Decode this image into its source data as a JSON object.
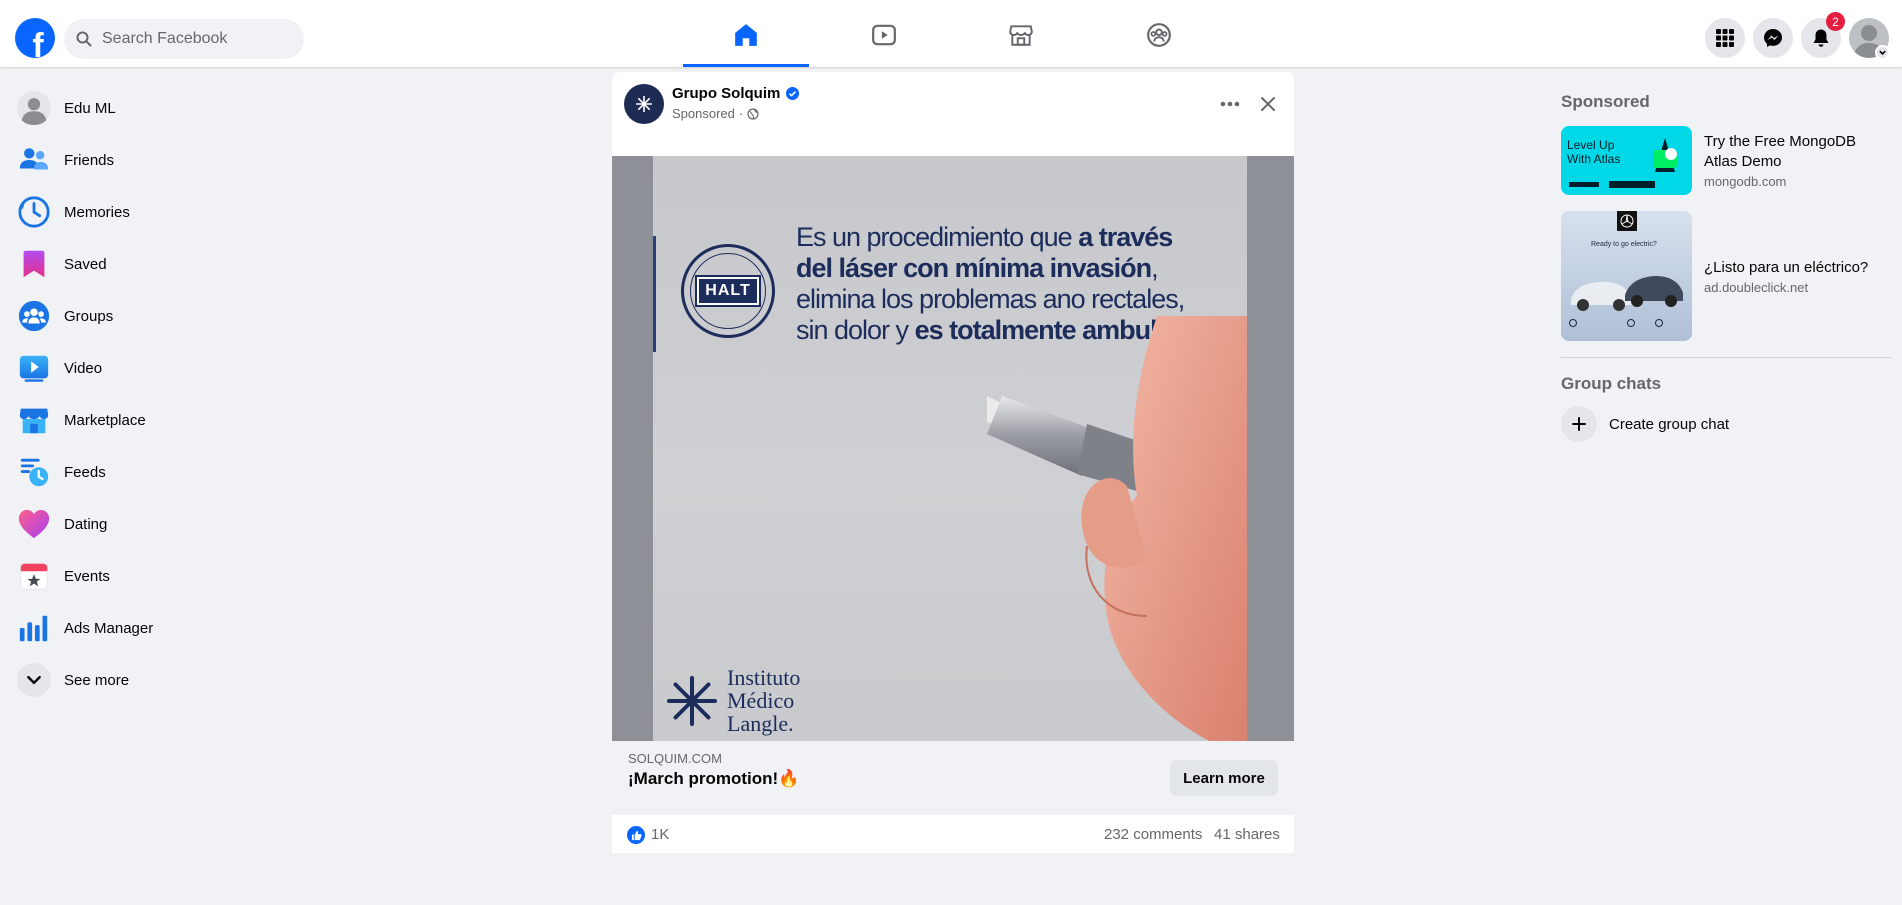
{
  "header": {
    "logo_letter": "f",
    "search_placeholder": "Search Facebook",
    "tabs": [
      "home-tab",
      "video-tab",
      "marketplace-tab",
      "groups-tab"
    ],
    "notifications_badge": "2"
  },
  "sidebar": {
    "items": [
      {
        "label": "Edu ML",
        "icon": "profile-avatar"
      },
      {
        "label": "Friends",
        "icon": "friends-icon"
      },
      {
        "label": "Memories",
        "icon": "memories-icon"
      },
      {
        "label": "Saved",
        "icon": "saved-icon"
      },
      {
        "label": "Groups",
        "icon": "groups-icon"
      },
      {
        "label": "Video",
        "icon": "video-icon"
      },
      {
        "label": "Marketplace",
        "icon": "marketplace-icon"
      },
      {
        "label": "Feeds",
        "icon": "feeds-icon"
      },
      {
        "label": "Dating",
        "icon": "dating-icon"
      },
      {
        "label": "Events",
        "icon": "events-icon"
      },
      {
        "label": "Ads Manager",
        "icon": "ads-manager-icon"
      },
      {
        "label": "See more",
        "icon": "chevron-down-icon"
      }
    ]
  },
  "post": {
    "page_name": "Grupo Solquim",
    "meta": "Sponsored",
    "meta_separator": "·",
    "image": {
      "headline_1": "Es un procedimiento que ",
      "headline_1b": "a través",
      "headline_2b": "del láser con mínima invasión",
      "headline_2": ",",
      "headline_3": "elimina los problemas ano rectales,",
      "headline_4": "sin dolor y ",
      "headline_4b": "es totalmente ambulatorio.",
      "seal_text": "HALT",
      "logo_line1": "Instituto",
      "logo_line2": "Médico",
      "logo_line3": "Langle."
    },
    "link_domain": "SOLQUIM.COM",
    "link_title": "¡March promotion!🔥",
    "cta_label": "Learn more",
    "likes": "1K",
    "comments": "232 comments",
    "shares": "41 shares"
  },
  "right_rail": {
    "sponsored_heading": "Sponsored",
    "ads": [
      {
        "title": "Try the Free MongoDB Atlas Demo",
        "domain": "mongodb.com",
        "thumb_text_1": "Level Up",
        "thumb_text_2": "With Atlas"
      },
      {
        "title": "¿Listo para un eléctrico?",
        "domain": "ad.doubleclick.net",
        "thumb_text_1": "Ready to go electric?"
      }
    ],
    "group_chats_heading": "Group chats",
    "create_group_label": "Create group chat"
  },
  "colors": {
    "brand_blue": "#0866ff",
    "badge_red": "#e41e3f",
    "ad_navy": "#1c2c5b"
  }
}
